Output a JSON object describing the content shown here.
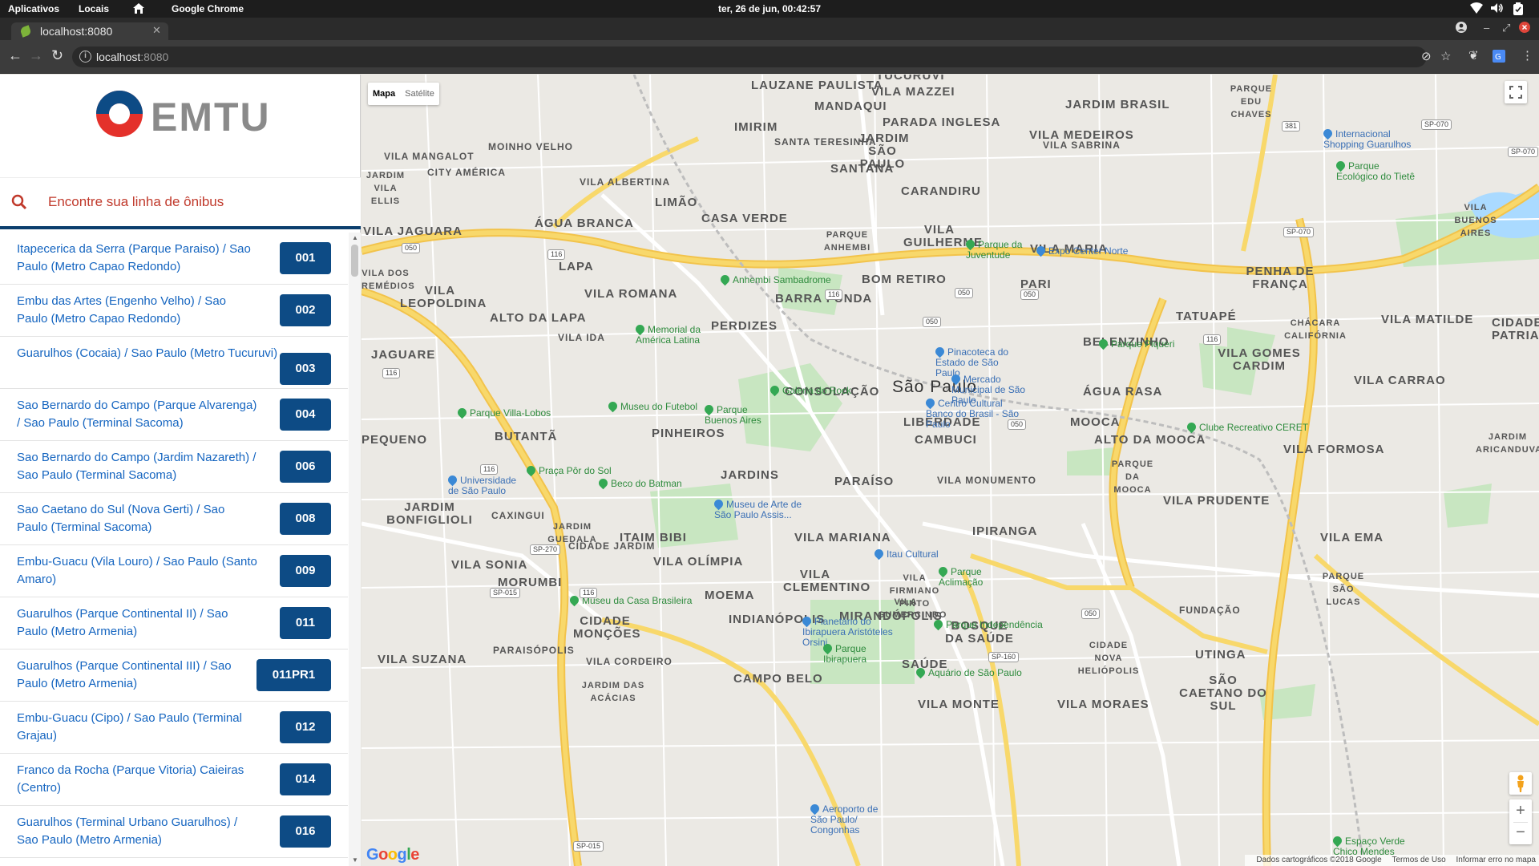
{
  "topbar": {
    "activities": "Aplicativos",
    "places": "Locais",
    "app": "Google Chrome",
    "clock": "ter, 26 de jun, 00:42:57"
  },
  "browser": {
    "tab_title": "localhost:8080",
    "url_host": "localhost",
    "url_port": ":8080"
  },
  "sidebar": {
    "logo_text": "EMTU",
    "search_placeholder": "Encontre sua linha de ônibus",
    "routes": [
      {
        "name": "Itapecerica da Serra (Parque Paraiso) / Sao Paulo (Metro Capao Redondo)",
        "code": "001"
      },
      {
        "name": "Embu das Artes (Engenho Velho) / Sao Paulo (Metro Capao Redondo)",
        "code": "002"
      },
      {
        "name": "Guarulhos (Cocaia) / Sao Paulo (Metro Tucuruvi)",
        "code": "003"
      },
      {
        "name": "Sao Bernardo do Campo (Parque Alvarenga) / Sao Paulo (Terminal Sacoma)",
        "code": "004"
      },
      {
        "name": "Sao Bernardo do Campo (Jardim Nazareth) / Sao Paulo (Terminal Sacoma)",
        "code": "006"
      },
      {
        "name": "Sao Caetano do Sul (Nova Gerti) / Sao Paulo (Terminal Sacoma)",
        "code": "008"
      },
      {
        "name": "Embu-Guacu (Vila Louro) / Sao Paulo (Santo Amaro)",
        "code": "009"
      },
      {
        "name": "Guarulhos (Parque Continental II) / Sao Paulo (Metro Armenia)",
        "code": "011"
      },
      {
        "name": "Guarulhos (Parque Continental III) / Sao Paulo (Metro Armenia)",
        "code": "011PR1"
      },
      {
        "name": "Embu-Guacu (Cipo) / Sao Paulo (Terminal Grajau)",
        "code": "012"
      },
      {
        "name": "Franco da Rocha (Parque Vitoria) Caieiras (Centro)",
        "code": "014"
      },
      {
        "name": "Guarulhos (Terminal Urbano Guarulhos) / Sao Paulo (Metro Armenia)",
        "code": "016"
      }
    ]
  },
  "map": {
    "type_map": "Mapa",
    "type_satellite": "Satélite",
    "city_label": "São Paulo",
    "districts": [
      "LAUZANE PAULISTA",
      "VILA MAZZEI",
      "MANDAQUI",
      "JARDIM BRASIL",
      "PARADA INGLESA",
      "IMIRIM",
      "VILA MEDEIROS",
      "MOINHO VELHO",
      "SANTA TERESINHA",
      "JARDIM SÃO PAULO",
      "VILA SABRINA",
      "VILA MANGALOT",
      "CITY AMÉRICA",
      "SANTANA",
      "JARDIM VILA ELLIS",
      "VILA ALBERTINA",
      "CARANDIRU",
      "LIMÃO",
      "CASA VERDE",
      "VILA GUILHERME",
      "VILA JAGUARA",
      "ÁGUA BRANCA",
      "VILA MARIA",
      "PARQUE ANHEMBI",
      "LAPA",
      "PENHA DE FRANÇA",
      "BOM RETIRO",
      "PARI",
      "VILA LEOPOLDINA",
      "VILA ROMANA",
      "BARRA FUNDA",
      "TATUAPÉ",
      "ALTO DA LAPA",
      "VILA MATILDE",
      "PERDIZES",
      "VILA IDA",
      "CHÁCARA CALIFÓRNIA",
      "BELENZINHO",
      "JAGUARE",
      "VILA GOMES CARDIM",
      "VILA CARRAO",
      "CONSOLAÇÃO",
      "ÁGUA RASA",
      "MOOCA",
      "LIBERDADE",
      "BUTANTÃ",
      "PINHEIROS",
      "CAMBUCI",
      "ALTO DA MOOCA",
      "VILA FORMOSA",
      "PEQUENO",
      "JARDINS",
      "PARAÍSO",
      "VILA MONUMENTO",
      "PARQUE DA MOOCA",
      "VILA PRUDENTE",
      "JARDIM BONFIGLIOLI",
      "CAXINGUI",
      "JARDIM GUEDALA",
      "ITAIM BIBI",
      "VILA MARIANA",
      "IPIRANGA",
      "CIDADE JARDIM",
      "VILA EMA",
      "VILA SONIA",
      "VILA OLÍMPIA",
      "MORUMBI",
      "VILA CLEMENTINO",
      "VILA FIRMIANO PINTO",
      "PARQUE SÃO LUCAS",
      "MOEMA",
      "VILA GUMERCINDO",
      "FUNDAÇÃO",
      "CIDADE MONÇÕES",
      "INDIANÓPOLIS",
      "MIRANDÓPOLIS",
      "BOSQUE DA SAÚDE",
      "PARAISÓPOLIS",
      "CIDADE NOVA HELIÓPOLIS",
      "VILA SUZANA",
      "VILA CORDEIRO",
      "SAÚDE",
      "UTINGA",
      "CAMPO BELO",
      "JARDIM DAS ACÁCIAS",
      "VILA MONTE",
      "VILA MORAES",
      "SÃO CAETANO DO SUL",
      "PARQUE EDU CHAVES",
      "VILA BUENOS AIRES",
      "JARDIM ARICANDUVA",
      "CIDADE PATRIARCA",
      "VILA DOS REMÉDIOS",
      "TUCURUVI"
    ],
    "pois": [
      {
        "label": "Internacional Shopping Guarulhos",
        "kind": "blue"
      },
      {
        "label": "Parque Ecológico do Tietê",
        "kind": "green"
      },
      {
        "label": "Parque da Juventude",
        "kind": "green"
      },
      {
        "label": "Expo Center Norte",
        "kind": "blue"
      },
      {
        "label": "Anhembi Sambadrome",
        "kind": "green"
      },
      {
        "label": "Memorial da América Latina",
        "kind": "blue"
      },
      {
        "label": "Parque Piqueri",
        "kind": "green"
      },
      {
        "label": "Pinacoteca do Estado de São Paulo",
        "kind": "blue"
      },
      {
        "label": "Mercado Municipal de São Paulo",
        "kind": "blue"
      },
      {
        "label": "Galeria do Rock",
        "kind": "blue"
      },
      {
        "label": "Centro Cultural Banco do Brasil - São Paulo",
        "kind": "blue"
      },
      {
        "label": "Parque Villa-Lobos",
        "kind": "green"
      },
      {
        "label": "Museu do Futebol",
        "kind": "green"
      },
      {
        "label": "Parque Buenos Aires",
        "kind": "green"
      },
      {
        "label": "Clube Recreativo CERET",
        "kind": "green"
      },
      {
        "label": "Praça Pôr do Sol",
        "kind": "green"
      },
      {
        "label": "Beco do Batman",
        "kind": "green"
      },
      {
        "label": "Universidade de São Paulo",
        "kind": "blue"
      },
      {
        "label": "Museu de Arte de São Paulo Assis...",
        "kind": "blue"
      },
      {
        "label": "Itau Cultural",
        "kind": "blue"
      },
      {
        "label": "Parque Aclimação",
        "kind": "green"
      },
      {
        "label": "Museu da Casa Brasileira",
        "kind": "green"
      },
      {
        "label": "Parque Independência",
        "kind": "green"
      },
      {
        "label": "Planetário do Ibirapuera Aristóteles Orsini",
        "kind": "blue"
      },
      {
        "label": "Parque Ibirapuera",
        "kind": "green"
      },
      {
        "label": "Aquário de São Paulo",
        "kind": "green"
      },
      {
        "label": "Aeroporto de São Paulo/ Congonhas",
        "kind": "blue"
      },
      {
        "label": "Espaço Verde Chico Mendes",
        "kind": "green"
      }
    ],
    "shields": [
      "381",
      "SP-070",
      "SP-070",
      "050",
      "116",
      "050",
      "116",
      "050",
      "SP-070",
      "116",
      "050",
      "116",
      "116",
      "SP-270",
      "SP-015",
      "116",
      "050",
      "SP-160",
      "050",
      "SP-015"
    ],
    "attribution": "Dados cartográficos ©2018 Google",
    "terms": "Termos de Uso",
    "report": "Informar erro no mapa",
    "google": "Google"
  },
  "colors": {
    "brand_blue": "#0d4b85",
    "brand_red": "#e4312b",
    "link_blue": "#1565c0",
    "search_red": "#c0392b",
    "highway": "#f8d86b",
    "park": "#c8e6c1",
    "water": "#aadaff"
  }
}
